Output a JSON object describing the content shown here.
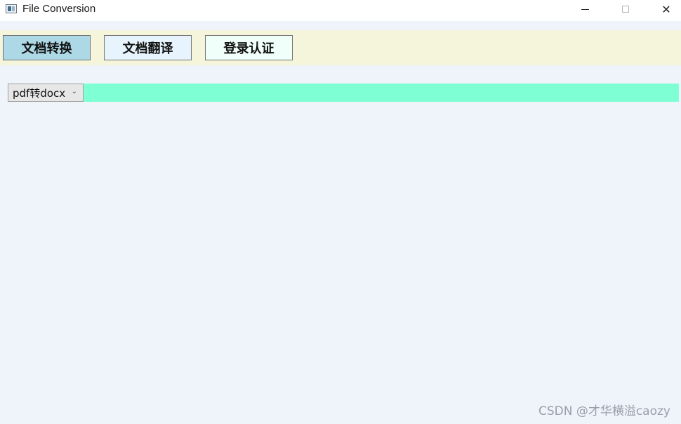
{
  "window": {
    "title": "File Conversion",
    "minimize_symbol": "",
    "close_symbol": "✕"
  },
  "nav": {
    "items": [
      {
        "label": "文档转换",
        "bg": "#add8e6"
      },
      {
        "label": "文档翻译",
        "bg": "#e7f4fd"
      },
      {
        "label": "登录认证",
        "bg": "#f0fff9"
      }
    ]
  },
  "conversion": {
    "selected": "pdf转docx",
    "arrow": "⌄",
    "bar_color": "#7fffd4"
  },
  "watermark": "CSDN @才华横溢caozy",
  "colors": {
    "topbar": "#f5f5dc",
    "background": "#eff3fa"
  }
}
